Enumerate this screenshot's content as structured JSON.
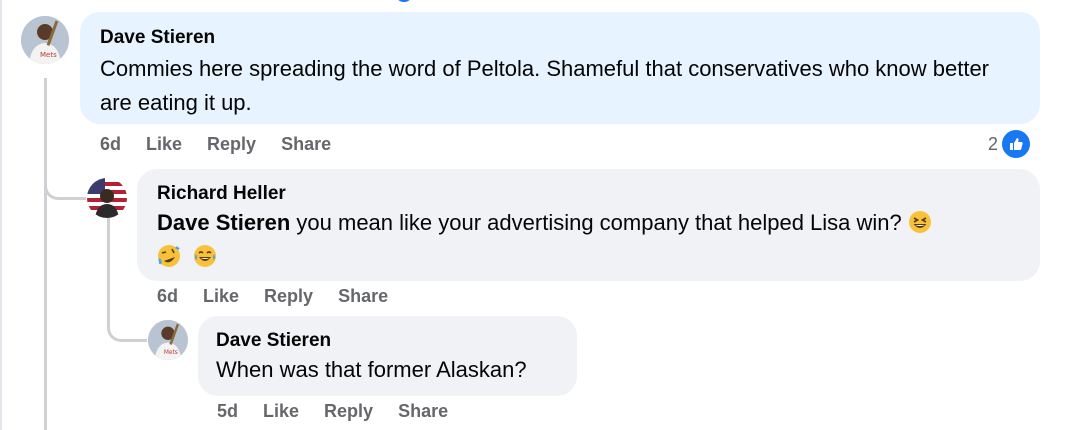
{
  "comments": [
    {
      "author": "Dave Stieren",
      "text": "Commies here spreading the word of Peltola. Shameful that conservatives who know better are eating it up.",
      "time": "6d",
      "like": "Like",
      "reply": "Reply",
      "share": "Share",
      "reaction_count": "2",
      "reaction_icon": "like-icon",
      "bubble_color": "#e7f3ff"
    },
    {
      "author": "Richard Heller",
      "mention": "Dave Stieren",
      "text": " you mean like your advertising company that helped Lisa win?",
      "emojis": [
        "grinning-squinting-face",
        "rolling-laughing-face",
        "tears-of-joy-face"
      ],
      "time": "6d",
      "like": "Like",
      "reply": "Reply",
      "share": "Share",
      "bubble_color": "#f0f2f5"
    },
    {
      "author": "Dave Stieren",
      "text": "When was that former Alaskan?",
      "time": "5d",
      "like": "Like",
      "reply": "Reply",
      "share": "Share",
      "bubble_color": "#f0f2f5"
    }
  ],
  "colors": {
    "accent": "#1877f2",
    "secondary_text": "#65676b",
    "thread_line": "#ced0d4"
  }
}
